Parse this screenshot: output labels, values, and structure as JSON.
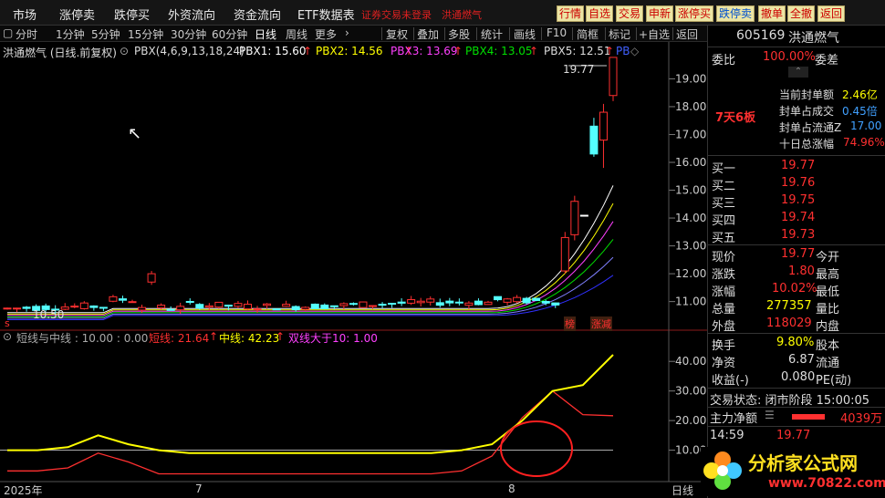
{
  "menu": {
    "items": [
      "市场",
      "涨停卖",
      "跌停买",
      "外资流向",
      "资金流向",
      "ETF数据表"
    ],
    "notice": "证券交易未登录",
    "stock_tag": "洪通燃气",
    "buttons": [
      "行情",
      "自选",
      "交易",
      "申新",
      "涨停买",
      "跌停卖",
      "撤单",
      "全撤",
      "返回"
    ]
  },
  "periods": [
    "分时",
    "1分钟",
    "5分钟",
    "15分钟",
    "30分钟",
    "60分钟",
    "日线",
    "周线",
    "更多"
  ],
  "tools": [
    "复权",
    "叠加",
    "多股",
    "统计",
    "画线",
    "F10",
    "简框",
    "标记",
    "+自选",
    "返回"
  ],
  "info": {
    "name": "洪通燃气 (日线.前复权)",
    "pbx": "PBX(4,6,9,13,18,24)",
    "pbx1": "PBX1: 15.60",
    "pbx2": "PBX2: 14.56",
    "pbx3": "PBX3: 13.69",
    "pbx4": "PBX4: 13.05",
    "pbx5": "PBX5: 12.51",
    "pb6": "PB",
    "arrow": "↑"
  },
  "price_axis": [
    "19.00",
    "18.00",
    "17.00",
    "16.00",
    "15.00",
    "14.00",
    "13.00",
    "12.00",
    "11.00"
  ],
  "annotations": {
    "high": "19.77",
    "low": "10.50",
    "tag1": "榜",
    "tag2": "涨减"
  },
  "indicator": {
    "title": "短线与中线 : 10.00 : 0.00",
    "short": "短线: 21.64",
    "mid": "中线: 42.23",
    "bigger": "双线大于10: 1.00",
    "axis": [
      "40.00",
      "30.00",
      "20.00",
      "10.00"
    ]
  },
  "xaxis": {
    "labels": [
      "2025年",
      "7",
      "8"
    ],
    "tab": "日线"
  },
  "rp": {
    "code": "605169",
    "name": "洪通燃气",
    "wb_label": "委比",
    "wb_val": "100.00%",
    "wc_label": "委差",
    "badge": "7天6板",
    "stats": [
      {
        "l": "当前封单额",
        "v": "2.46亿"
      },
      {
        "l": "封单占成交",
        "v": "0.45倍"
      },
      {
        "l": "封单占流通Z",
        "v": "17.00"
      },
      {
        "l": "十日总涨幅",
        "v": "74.96%"
      }
    ],
    "bids": [
      {
        "l": "买一",
        "v": "19.77"
      },
      {
        "l": "买二",
        "v": "19.76"
      },
      {
        "l": "买三",
        "v": "19.75"
      },
      {
        "l": "买四",
        "v": "19.74"
      },
      {
        "l": "买五",
        "v": "19.73"
      }
    ],
    "quote": [
      {
        "l": "现价",
        "v": "19.77",
        "r": "今开"
      },
      {
        "l": "涨跌",
        "v": "1.80",
        "r": "最高"
      },
      {
        "l": "涨幅",
        "v": "10.02%",
        "r": "最低"
      },
      {
        "l": "总量",
        "v": "277357",
        "r": "量比"
      },
      {
        "l": "外盘",
        "v": "118029",
        "r": "内盘"
      }
    ],
    "quote2": [
      {
        "l": "换手",
        "v": "9.80%",
        "r": "股本"
      },
      {
        "l": "净资",
        "v": "6.87",
        "r": "流通"
      },
      {
        "l": "收益(-)",
        "v": "0.080",
        "r": "PE(动)"
      }
    ],
    "status": "交易状态: 闭市阶段 15:00:05",
    "fund": "主力净额",
    "fund_val": "4039万",
    "tick_time": "14:59",
    "tick_price": "19.77"
  },
  "logo": {
    "text": "分析家公式网",
    "url": "www.70822.com"
  },
  "colors": {
    "up": "#ff3030",
    "down": "#54ffff",
    "yellow": "#ffff00",
    "magenta": "#ff40ff",
    "green": "#00e000",
    "blue": "#3030ff"
  },
  "chart_data": {
    "type": "candlestick",
    "x": [
      "2025年",
      "7",
      "8"
    ],
    "price_range": [
      10.3,
      19.8
    ],
    "candles_recent": [
      {
        "o": 12.1,
        "c": 13.3,
        "h": 13.5,
        "l": 12.0
      },
      {
        "o": 13.4,
        "c": 14.6,
        "h": 14.8,
        "l": 13.2
      },
      {
        "o": 14.1,
        "c": 14.1,
        "h": 14.1,
        "l": 14.1
      },
      {
        "o": 17.3,
        "c": 16.3,
        "h": 17.6,
        "l": 16.2
      },
      {
        "o": 16.8,
        "c": 17.8,
        "h": 18.1,
        "l": 15.8
      },
      {
        "o": 18.4,
        "c": 19.77,
        "h": 19.77,
        "l": 18.2
      }
    ],
    "indicator_range": [
      0,
      45
    ],
    "short": [
      3,
      3,
      4,
      9,
      6,
      2,
      2,
      2,
      2,
      2,
      2,
      2,
      2,
      2,
      2,
      3,
      8,
      21,
      30,
      22,
      21.64
    ],
    "mid": [
      10,
      10,
      11,
      15,
      12,
      10,
      9,
      9,
      9,
      9,
      9,
      9,
      9,
      9,
      9,
      10,
      12,
      20,
      30,
      32,
      42.23
    ]
  }
}
